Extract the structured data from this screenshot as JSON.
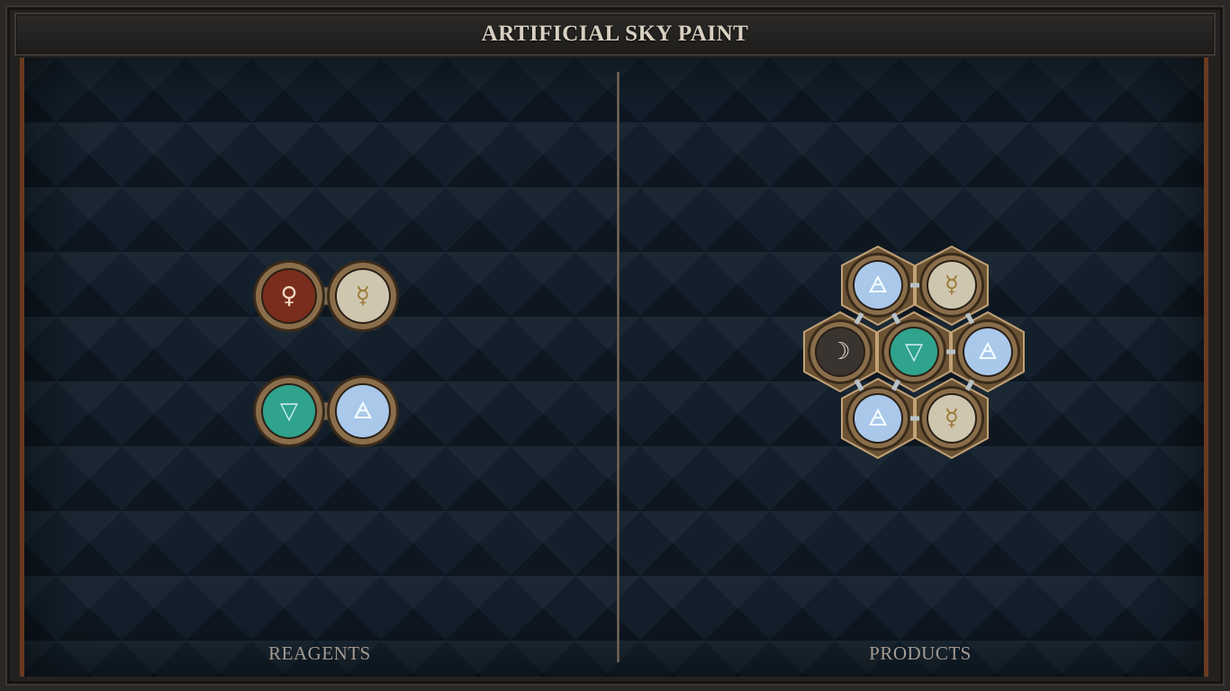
{
  "window": {
    "title": "ARTIFICIAL SKY PAINT"
  },
  "panels": {
    "reagents_label": "REAGENTS",
    "products_label": "PRODUCTS"
  },
  "reagents": [
    {
      "atoms": [
        {
          "element": "copper",
          "symbol": "♀",
          "color": "#7a2d1c",
          "glyph_color": "#f1d7c2"
        },
        {
          "element": "quicksilver",
          "symbol": "☿",
          "color": "#cfc6b0",
          "glyph_color": "#9a7a36"
        }
      ]
    },
    {
      "atoms": [
        {
          "element": "water",
          "symbol": "▽",
          "color": "#2fa38c",
          "glyph_color": "#cfeef0"
        },
        {
          "element": "air",
          "symbol": "🜁",
          "color": "#a9c8ea",
          "glyph_color": "#f2fbff"
        }
      ]
    }
  ],
  "product": {
    "atoms": [
      {
        "element": "air",
        "symbol": "🜁",
        "color": "#a9c8ea",
        "glyph_color": "#f2fbff"
      },
      {
        "element": "quicksilver",
        "symbol": "☿",
        "color": "#cfc6b0",
        "glyph_color": "#9a7a36"
      },
      {
        "element": "silver",
        "symbol": "☽",
        "color": "#3a3431",
        "glyph_color": "#e8dcd0"
      },
      {
        "element": "water",
        "symbol": "▽",
        "color": "#2fa38c",
        "glyph_color": "#cfeef0"
      },
      {
        "element": "air",
        "symbol": "🜁",
        "color": "#a9c8ea",
        "glyph_color": "#f2fbff"
      },
      {
        "element": "air",
        "symbol": "🜁",
        "color": "#a9c8ea",
        "glyph_color": "#f2fbff"
      },
      {
        "element": "quicksilver",
        "symbol": "☿",
        "color": "#cfc6b0",
        "glyph_color": "#9a7a36"
      }
    ]
  },
  "colors": {
    "frame_accent": "#6a3a1f",
    "board_bg": "#13202c",
    "bond_metal": "#8e9aa3",
    "atom_rim": "#8a6e4b"
  }
}
